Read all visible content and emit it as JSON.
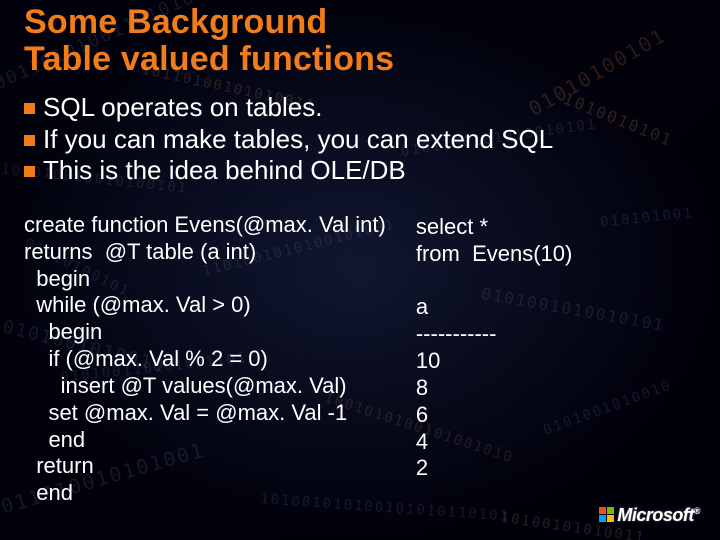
{
  "title_line1": "Some Background",
  "title_line2": "Table valued functions",
  "bullets": {
    "b1": "SQL operates on tables.",
    "b2": "If you can make tables, you can extend SQL",
    "b3": "This is the idea behind OLE/DB"
  },
  "code": "create function Evens(@max. Val int)\nreturns  @T table (a int)\n  begin\n  while (@max. Val > 0)\n    begin\n    if (@max. Val % 2 = 0)\n      insert @T values(@max. Val)\n    set @max. Val = @max. Val -1\n    end\n  return\n  end",
  "result": "select *\nfrom  Evens(10)\n\na\n-----------\n10\n8\n6\n4\n2",
  "logo_text": "Microsoft",
  "logo_tm": "®"
}
